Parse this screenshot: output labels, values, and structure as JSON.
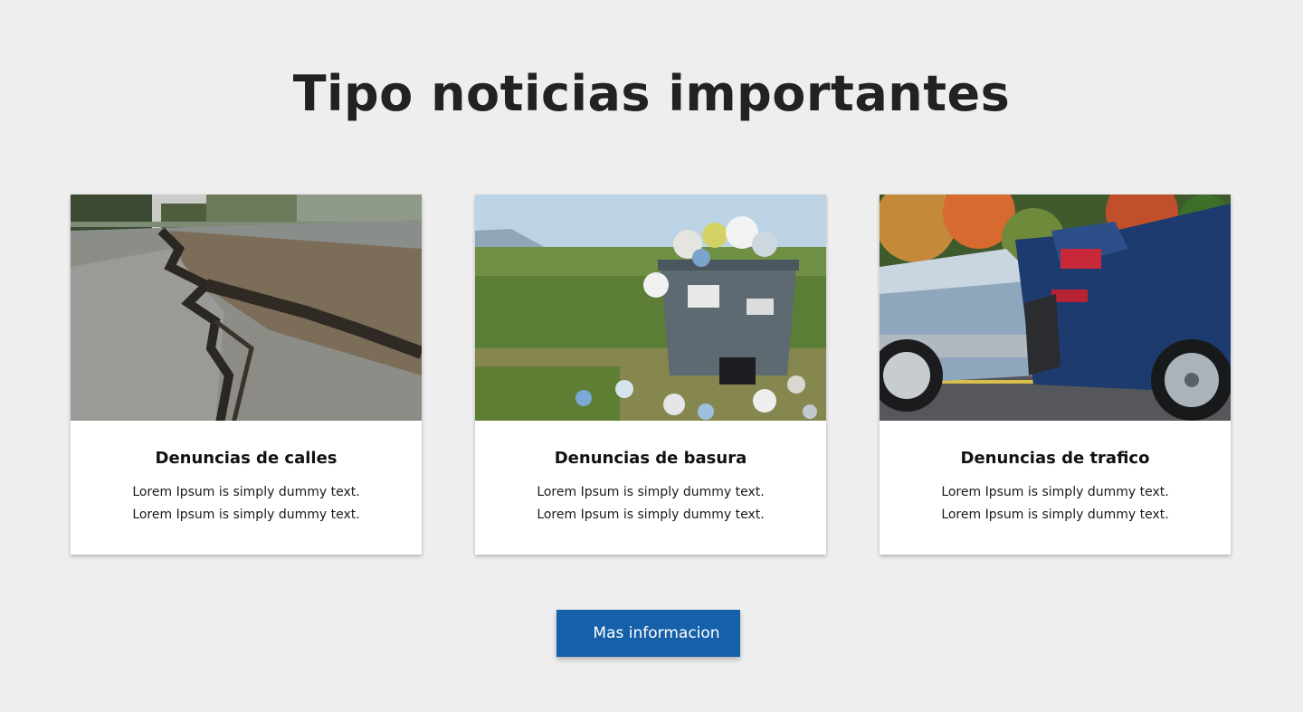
{
  "section": {
    "title": "Tipo noticias importantes"
  },
  "cards": [
    {
      "image": "cracked-road",
      "title": "Denuncias de calles",
      "line1": "Lorem Ipsum is simply dummy text.",
      "line2": "Lorem Ipsum is simply dummy text."
    },
    {
      "image": "overflowing-trash-bin",
      "title": "Denuncias de basura",
      "line1": "Lorem Ipsum is simply dummy text.",
      "line2": "Lorem Ipsum is simply dummy text."
    },
    {
      "image": "car-collision",
      "title": "Denuncias de trafico",
      "line1": "Lorem Ipsum is simply dummy text.",
      "line2": "Lorem Ipsum is simply dummy text."
    }
  ],
  "cta": {
    "label": "Mas informacion"
  },
  "colors": {
    "background": "#eeeeee",
    "button": "#1560a8",
    "card": "#ffffff"
  }
}
